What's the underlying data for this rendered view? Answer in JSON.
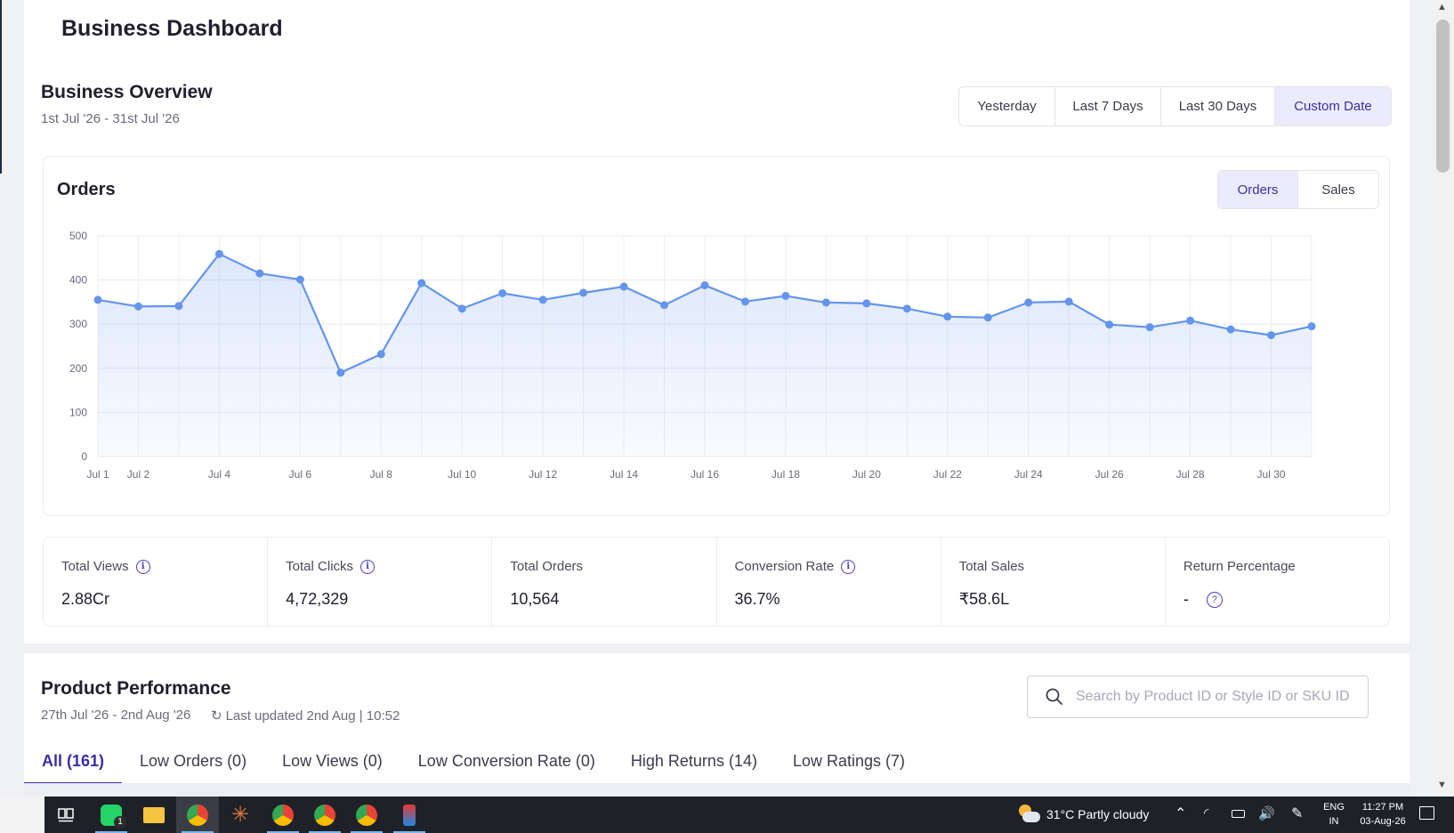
{
  "page": {
    "title": "Business Dashboard"
  },
  "overview": {
    "title": "Business Overview",
    "date_range": "1st Jul '26 - 31st Jul '26",
    "ranges": [
      "Yesterday",
      "Last 7 Days",
      "Last 30 Days",
      "Custom Date"
    ],
    "active_range": "Custom Date"
  },
  "chart_card": {
    "title": "Orders",
    "toggles": [
      "Orders",
      "Sales"
    ],
    "active_toggle": "Orders"
  },
  "chart_data": {
    "type": "area",
    "title": "Orders",
    "x": [
      "Jul 1",
      "Jul 2",
      "Jul 3",
      "Jul 4",
      "Jul 5",
      "Jul 6",
      "Jul 7",
      "Jul 8",
      "Jul 9",
      "Jul 10",
      "Jul 11",
      "Jul 12",
      "Jul 13",
      "Jul 14",
      "Jul 15",
      "Jul 16",
      "Jul 17",
      "Jul 18",
      "Jul 19",
      "Jul 20",
      "Jul 21",
      "Jul 22",
      "Jul 23",
      "Jul 24",
      "Jul 25",
      "Jul 26",
      "Jul 27",
      "Jul 28",
      "Jul 29",
      "Jul 30",
      "Jul 31"
    ],
    "x_tick_labels": [
      "Jul 1",
      "Jul 2",
      "Jul 4",
      "Jul 6",
      "Jul 8",
      "Jul 10",
      "Jul 12",
      "Jul 14",
      "Jul 16",
      "Jul 18",
      "Jul 20",
      "Jul 22",
      "Jul 24",
      "Jul 26",
      "Jul 28",
      "Jul 30"
    ],
    "series": [
      {
        "values": [
          355,
          340,
          341,
          459,
          415,
          401,
          190,
          232,
          393,
          335,
          370,
          355,
          371,
          385,
          343,
          388,
          351,
          364,
          349,
          347,
          335,
          317,
          315,
          349,
          351,
          299,
          293,
          308,
          288,
          275,
          295
        ]
      }
    ],
    "ylim": [
      0,
      500
    ],
    "yticks": [
      0,
      100,
      200,
      300,
      400,
      500
    ],
    "grid": true,
    "color": "#6495ed"
  },
  "metrics": [
    {
      "label": "Total Views",
      "value": "2.88Cr",
      "info": true
    },
    {
      "label": "Total Clicks",
      "value": "4,72,329",
      "info": true
    },
    {
      "label": "Total Orders",
      "value": "10,564",
      "info": false
    },
    {
      "label": "Conversion Rate",
      "value": "36.7%",
      "info": true
    },
    {
      "label": "Total Sales",
      "value": "₹58.6L",
      "info": false
    },
    {
      "label": "Return Percentage",
      "value": "-",
      "info": false,
      "help": true
    }
  ],
  "product_performance": {
    "title": "Product Performance",
    "date_range": "27th Jul '26 - 2nd Aug '26",
    "last_updated": "Last updated 2nd Aug | 10:52",
    "search_placeholder": "Search by Product ID or Style ID or SKU ID",
    "tabs": [
      "All (161)",
      "Low Orders (0)",
      "Low Views (0)",
      "Low Conversion Rate (0)",
      "High Returns (14)",
      "Low Ratings (7)"
    ],
    "active_tab": "All (161)"
  },
  "taskbar": {
    "whatsapp_badge": "1",
    "weather": "31°C  Partly cloudy",
    "lang_top": "ENG",
    "lang_bottom": "IN",
    "time": "11:27 PM",
    "date": "03-Aug-26"
  }
}
